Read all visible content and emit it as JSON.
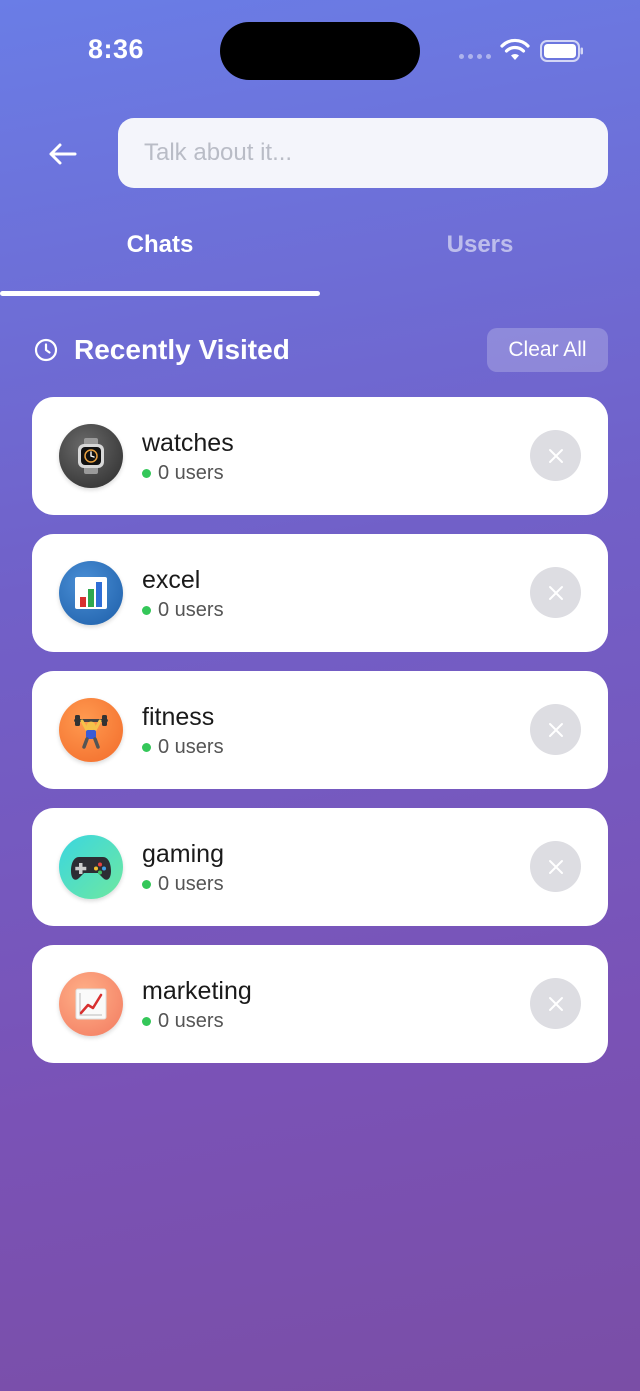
{
  "status": {
    "time": "8:36"
  },
  "search": {
    "placeholder": "Talk about it..."
  },
  "tabs": [
    {
      "label": "Chats",
      "active": true
    },
    {
      "label": "Users",
      "active": false
    }
  ],
  "section": {
    "title": "Recently Visited",
    "clear_label": "Clear All"
  },
  "chats": [
    {
      "name": "watches",
      "users": "0 users",
      "icon": "watch-icon"
    },
    {
      "name": "excel",
      "users": "0 users",
      "icon": "bar-chart-icon"
    },
    {
      "name": "fitness",
      "users": "0 users",
      "icon": "weightlifter-icon"
    },
    {
      "name": "gaming",
      "users": "0 users",
      "icon": "gamepad-icon"
    },
    {
      "name": "marketing",
      "users": "0 users",
      "icon": "trending-chart-icon"
    }
  ],
  "colors": {
    "online": "#34c759",
    "accent_gradient_top": "#6a7de6",
    "accent_gradient_bottom": "#7a4ea6"
  }
}
